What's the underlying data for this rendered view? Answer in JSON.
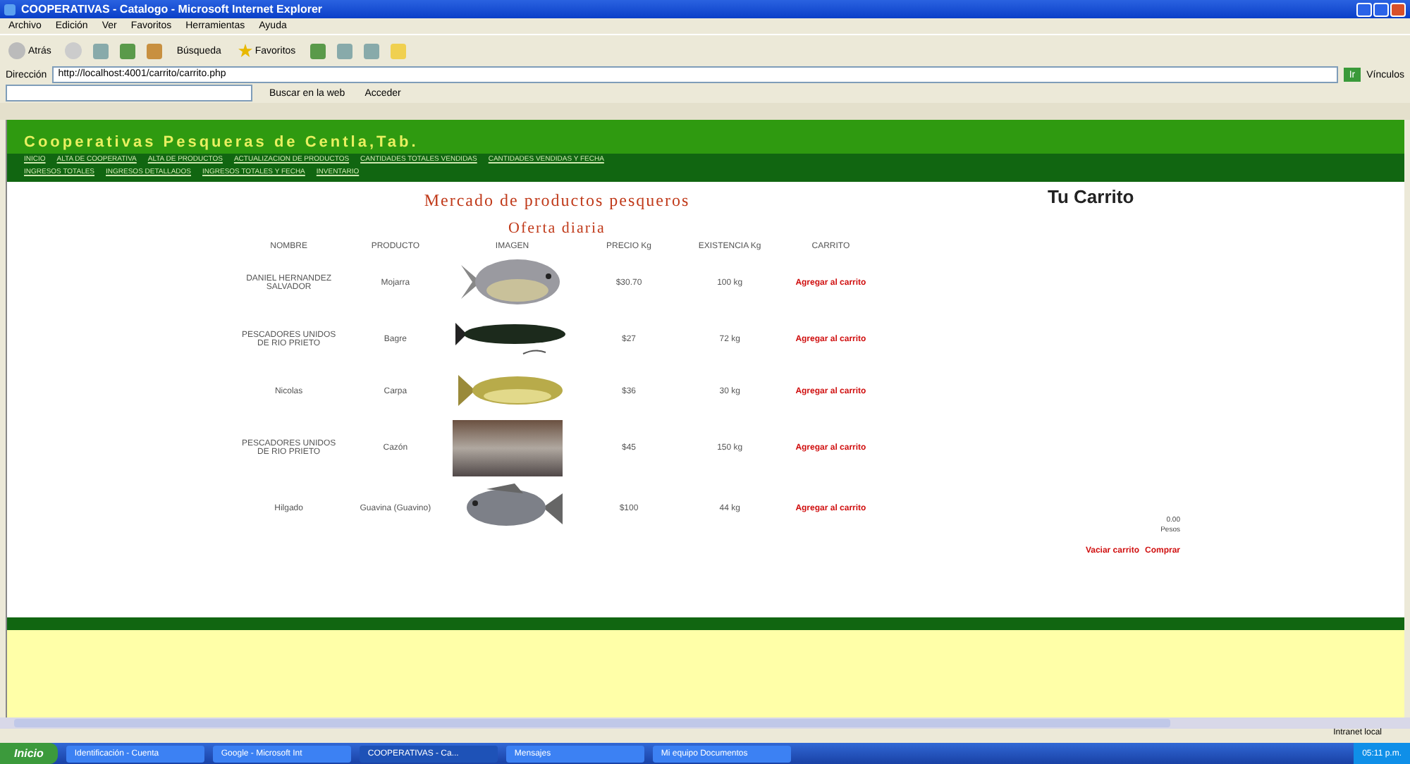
{
  "window": {
    "title": "COOPERATIVAS - Catalogo - Microsoft Internet Explorer"
  },
  "menu": [
    "Archivo",
    "Edición",
    "Ver",
    "Favoritos",
    "Herramientas",
    "Ayuda"
  ],
  "toolbar": {
    "back": "Atrás",
    "search": "Búsqueda",
    "favorites": "Favoritos"
  },
  "address": {
    "label": "Dirección",
    "value": "http://localhost:4001/carrito/carrito.php",
    "go": "Ir",
    "links": "Vínculos"
  },
  "search_bar": {
    "button": "Buscar en la web",
    "sign_in": "Acceder"
  },
  "site": {
    "title": "Cooperativas Pesqueras de Centla,Tab.",
    "nav_primary": [
      "INICIO",
      "ALTA DE COOPERATIVA",
      "ALTA DE PRODUCTOS",
      "ACTUALIZACION DE PRODUCTOS",
      "CANTIDADES TOTALES VENDIDAS",
      "CANTIDADES VENDIDAS Y FECHA"
    ],
    "nav_secondary": [
      "INGRESOS TOTALES",
      "INGRESOS DETALLADOS",
      "INGRESOS TOTALES Y FECHA",
      "INVENTARIO"
    ]
  },
  "market": {
    "title": "Mercado de productos pesqueros",
    "subtitle": "Oferta diaria",
    "columns": [
      "NOMBRE",
      "PRODUCTO",
      "IMAGEN",
      "PRECIO Kg",
      "EXISTENCIA Kg",
      "CARRITO"
    ],
    "rows": [
      {
        "name": "DANIEL HERNANDEZ SALVADOR",
        "product": "Mojarra",
        "kind": "round",
        "price": "$30.70",
        "stock": "100 kg",
        "action": "Agregar al carrito"
      },
      {
        "name": "PESCADORES UNIDOS DE RIO PRIETO",
        "product": "Bagre",
        "kind": "long",
        "price": "$27",
        "stock": "72 kg",
        "action": "Agregar al carrito"
      },
      {
        "name": "Nicolas",
        "product": "Carpa",
        "kind": "carp",
        "price": "$36",
        "stock": "30 kg",
        "action": "Agregar al carrito"
      },
      {
        "name": "PESCADORES UNIDOS DE RIO PRIETO",
        "product": "Cazón",
        "kind": "photo",
        "price": "$45",
        "stock": "150 kg",
        "action": "Agregar al carrito"
      },
      {
        "name": "Hilgado",
        "product": "Guavina (Guavino)",
        "kind": "perch",
        "price": "$100",
        "stock": "44 kg",
        "action": "Agregar al carrito"
      }
    ]
  },
  "cart": {
    "title": "Tu Carrito",
    "total": "0.00",
    "unit": "Pesos",
    "actions": [
      "Vaciar carrito",
      "Comprar"
    ]
  },
  "status_bar": {
    "zone": "Intranet local"
  },
  "taskbar": {
    "start": "Inicio",
    "tasks": [
      {
        "label": "Identificación - Cuenta",
        "selected": false
      },
      {
        "label": "Google - Microsoft Int",
        "selected": false
      },
      {
        "label": "COOPERATIVAS - Ca...",
        "selected": true
      },
      {
        "label": "Mensajes",
        "selected": false
      },
      {
        "label": "Mi equipo Documentos",
        "selected": false
      }
    ],
    "clock": "05:11 p.m."
  }
}
